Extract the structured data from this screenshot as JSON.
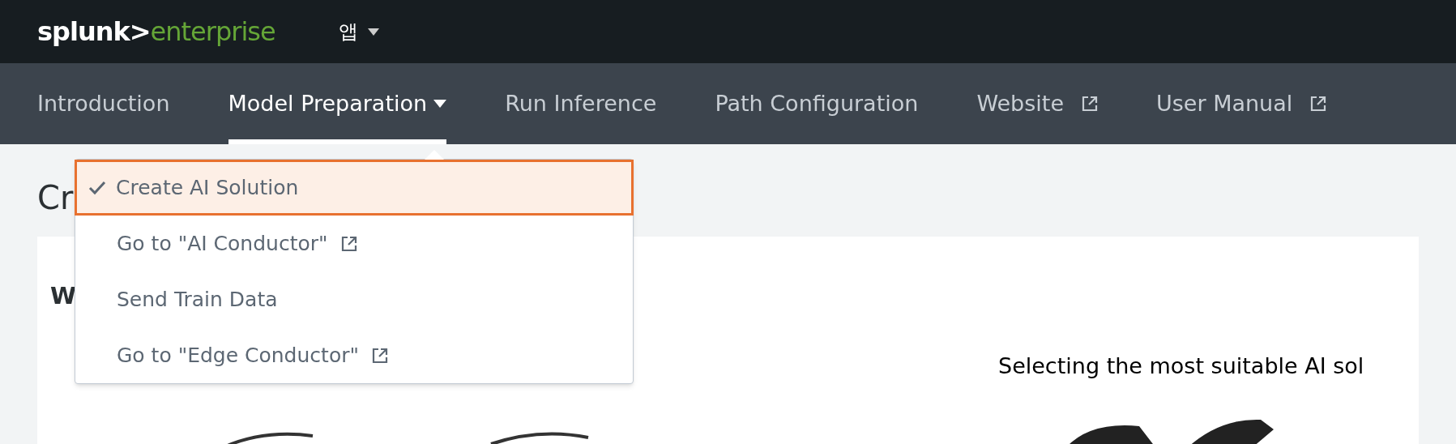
{
  "top_bar": {
    "logo": {
      "brand": "splunk>",
      "product": "enterprise"
    },
    "app_menu": {
      "label": "앱"
    }
  },
  "nav": [
    {
      "label": "Introduction",
      "selected": false,
      "kind": "link"
    },
    {
      "label": "Model Preparation",
      "selected": true,
      "kind": "menu"
    },
    {
      "label": "Run Inference",
      "selected": false,
      "kind": "link"
    },
    {
      "label": "Path Configuration",
      "selected": false,
      "kind": "link"
    },
    {
      "label": "Website",
      "selected": false,
      "kind": "external"
    },
    {
      "label": "User Manual",
      "selected": false,
      "kind": "external"
    }
  ],
  "page_title": "Cr",
  "card": {
    "heading": "W",
    "caption": "Selecting the most suitable AI sol"
  },
  "dropdown": [
    {
      "label": "Create AI Solution",
      "selected": true,
      "external": false
    },
    {
      "label": "Go to \"AI Conductor\"",
      "selected": false,
      "external": true
    },
    {
      "label": "Send Train Data",
      "selected": false,
      "external": false
    },
    {
      "label": "Go to \"Edge Conductor\"",
      "selected": false,
      "external": true
    }
  ]
}
